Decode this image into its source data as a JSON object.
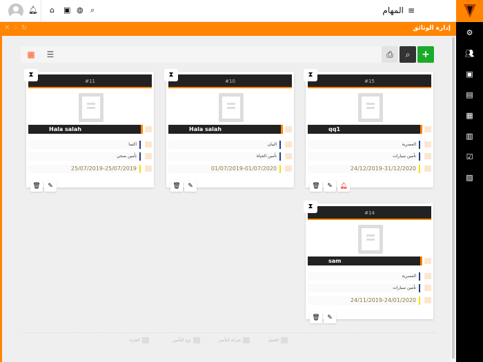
{
  "header": {
    "title": "المهام",
    "menu_icon": "≡"
  },
  "panel": {
    "title": "إدارة الوثائق"
  },
  "toolbar": {
    "add": "+",
    "search": "⌕",
    "print": "⎙"
  },
  "cards": [
    {
      "id": "#15",
      "client": "qq1",
      "company": "المصرية",
      "type": "تأمين سيارات",
      "period": "24/12/2019-31/12/2020",
      "alert": true
    },
    {
      "id": "#10",
      "client": "Hala salah",
      "company": "البيان",
      "type": "تأمين الحياة",
      "period": "01/07/2019-01/07/2020",
      "alert": false
    },
    {
      "id": "#11",
      "client": "Hala salah",
      "company": "اكسا",
      "type": "تأمين صحي",
      "period": "25/07/2019-25/07/2019",
      "alert": false
    },
    {
      "id": "#14",
      "client": "sam",
      "company": "المصرية",
      "type": "تأمين سيارات",
      "period": "24/11/2019-24/01/2020",
      "alert": false
    }
  ],
  "legend": {
    "client": "العميل",
    "company": "شركة التأمين",
    "type": "نوع التأمين",
    "period": "الفترة"
  },
  "colors": {
    "accent": "#ff8500",
    "add": "#1aab2a",
    "alert": "#ff0000"
  }
}
